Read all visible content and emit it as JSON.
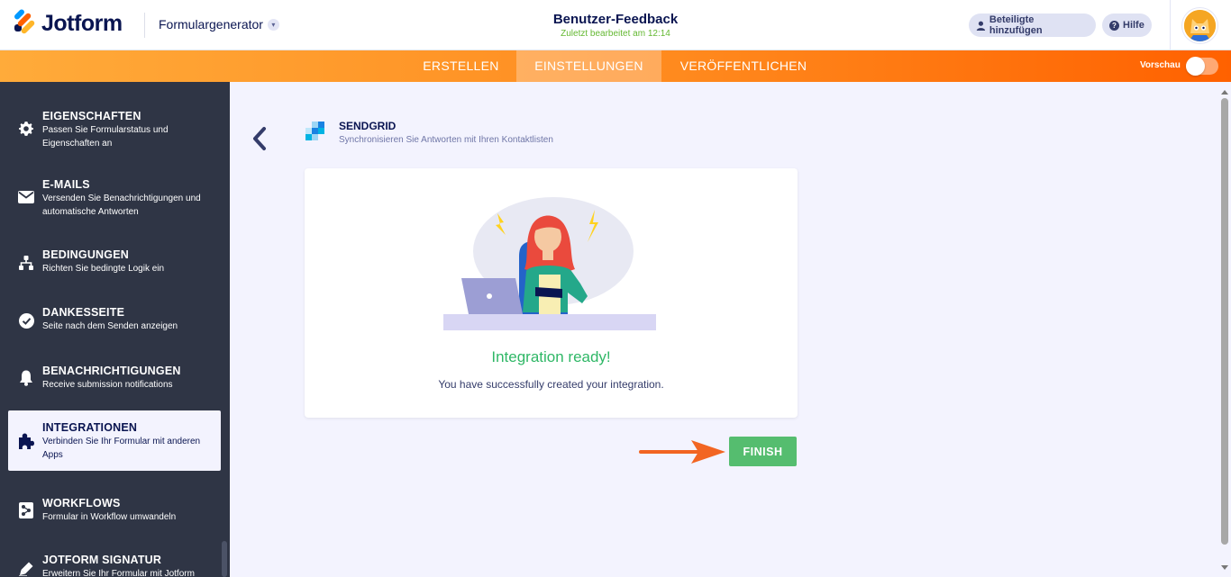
{
  "header": {
    "logo_text": "Jotform",
    "builder_label": "Formulargenerator",
    "form_title": "Benutzer-Feedback",
    "last_edited": "Zuletzt bearbeitet am 12:14",
    "add_participants": "Beteiligte hinzufügen",
    "help": "Hilfe"
  },
  "nav": {
    "tabs": [
      {
        "label": "ERSTELLEN"
      },
      {
        "label": "EINSTELLUNGEN"
      },
      {
        "label": "VERÖFFENTLICHEN"
      }
    ],
    "active_tab": "EINSTELLUNGEN",
    "preview_label": "Vorschau",
    "preview_on": false
  },
  "sidebar": {
    "items": [
      {
        "title": "EIGENSCHAFTEN",
        "desc": "Passen Sie Formularstatus und Eigenschaften an",
        "icon": "gear-icon"
      },
      {
        "title": "E-MAILS",
        "desc": "Versenden Sie Benachrichtigungen und automatische Antworten",
        "icon": "envelope-icon"
      },
      {
        "title": "BEDINGUNGEN",
        "desc": "Richten Sie bedingte Logik ein",
        "icon": "hierarchy-icon"
      },
      {
        "title": "DANKESSEITE",
        "desc": "Seite nach dem Senden anzeigen",
        "icon": "check-circle-icon"
      },
      {
        "title": "BENACHRICHTIGUNGEN",
        "desc": "Receive submission notifications",
        "icon": "bell-icon"
      },
      {
        "title": "INTEGRATIONEN",
        "desc": "Verbinden Sie Ihr Formular mit anderen Apps",
        "icon": "puzzle-icon"
      },
      {
        "title": "WORKFLOWS",
        "desc": "Formular in Workflow umwandeln",
        "icon": "workflow-icon"
      },
      {
        "title": "JOTFORM SIGNATUR",
        "desc": "Erweitern Sie Ihr Formular mit Jotform",
        "icon": "pen-icon"
      }
    ],
    "active_item": "INTEGRATIONEN"
  },
  "main": {
    "integration_name": "SENDGRID",
    "integration_desc": "Synchronisieren Sie Antworten mit Ihren Kontaktlisten",
    "ready_title": "Integration ready!",
    "ready_text": "You have successfully created your integration.",
    "finish_label": "FINISH"
  },
  "colors": {
    "brand_orange": "#ff6100",
    "success_green": "#2fb766",
    "finish_button": "#55bd6f",
    "sidebar_bg": "#2f3545"
  }
}
